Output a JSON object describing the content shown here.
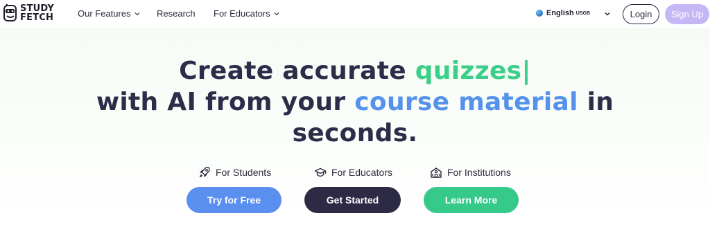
{
  "brand": {
    "line1": "STUDY",
    "line2": "FETCH"
  },
  "nav": {
    "links": [
      {
        "label": "Our Features",
        "has_dropdown": true
      },
      {
        "label": "Research",
        "has_dropdown": false
      },
      {
        "label": "For Educators",
        "has_dropdown": true
      }
    ],
    "language": {
      "name": "English",
      "code": "USGB",
      "icon": "globe-icon"
    },
    "login_label": "Login",
    "signup_label": "Sign Up"
  },
  "hero": {
    "line1_prefix": "Create accurate ",
    "line1_highlight": "quizzes",
    "caret": "|",
    "line2_prefix": "with AI from your ",
    "line2_highlight": "course material",
    "line2_suffix": " in",
    "line3": "seconds."
  },
  "audiences": [
    {
      "label": "For Students",
      "icon": "rocket-icon",
      "cta": "Try for Free"
    },
    {
      "label": "For Educators",
      "icon": "graduation-cap-icon",
      "cta": "Get Started"
    },
    {
      "label": "For Institutions",
      "icon": "school-building-icon",
      "cta": "Learn More"
    }
  ],
  "colors": {
    "green": "#3ccf89",
    "blue": "#5592ec",
    "dark": "#2d2a45",
    "signup_bg": "#c5b7f5"
  }
}
